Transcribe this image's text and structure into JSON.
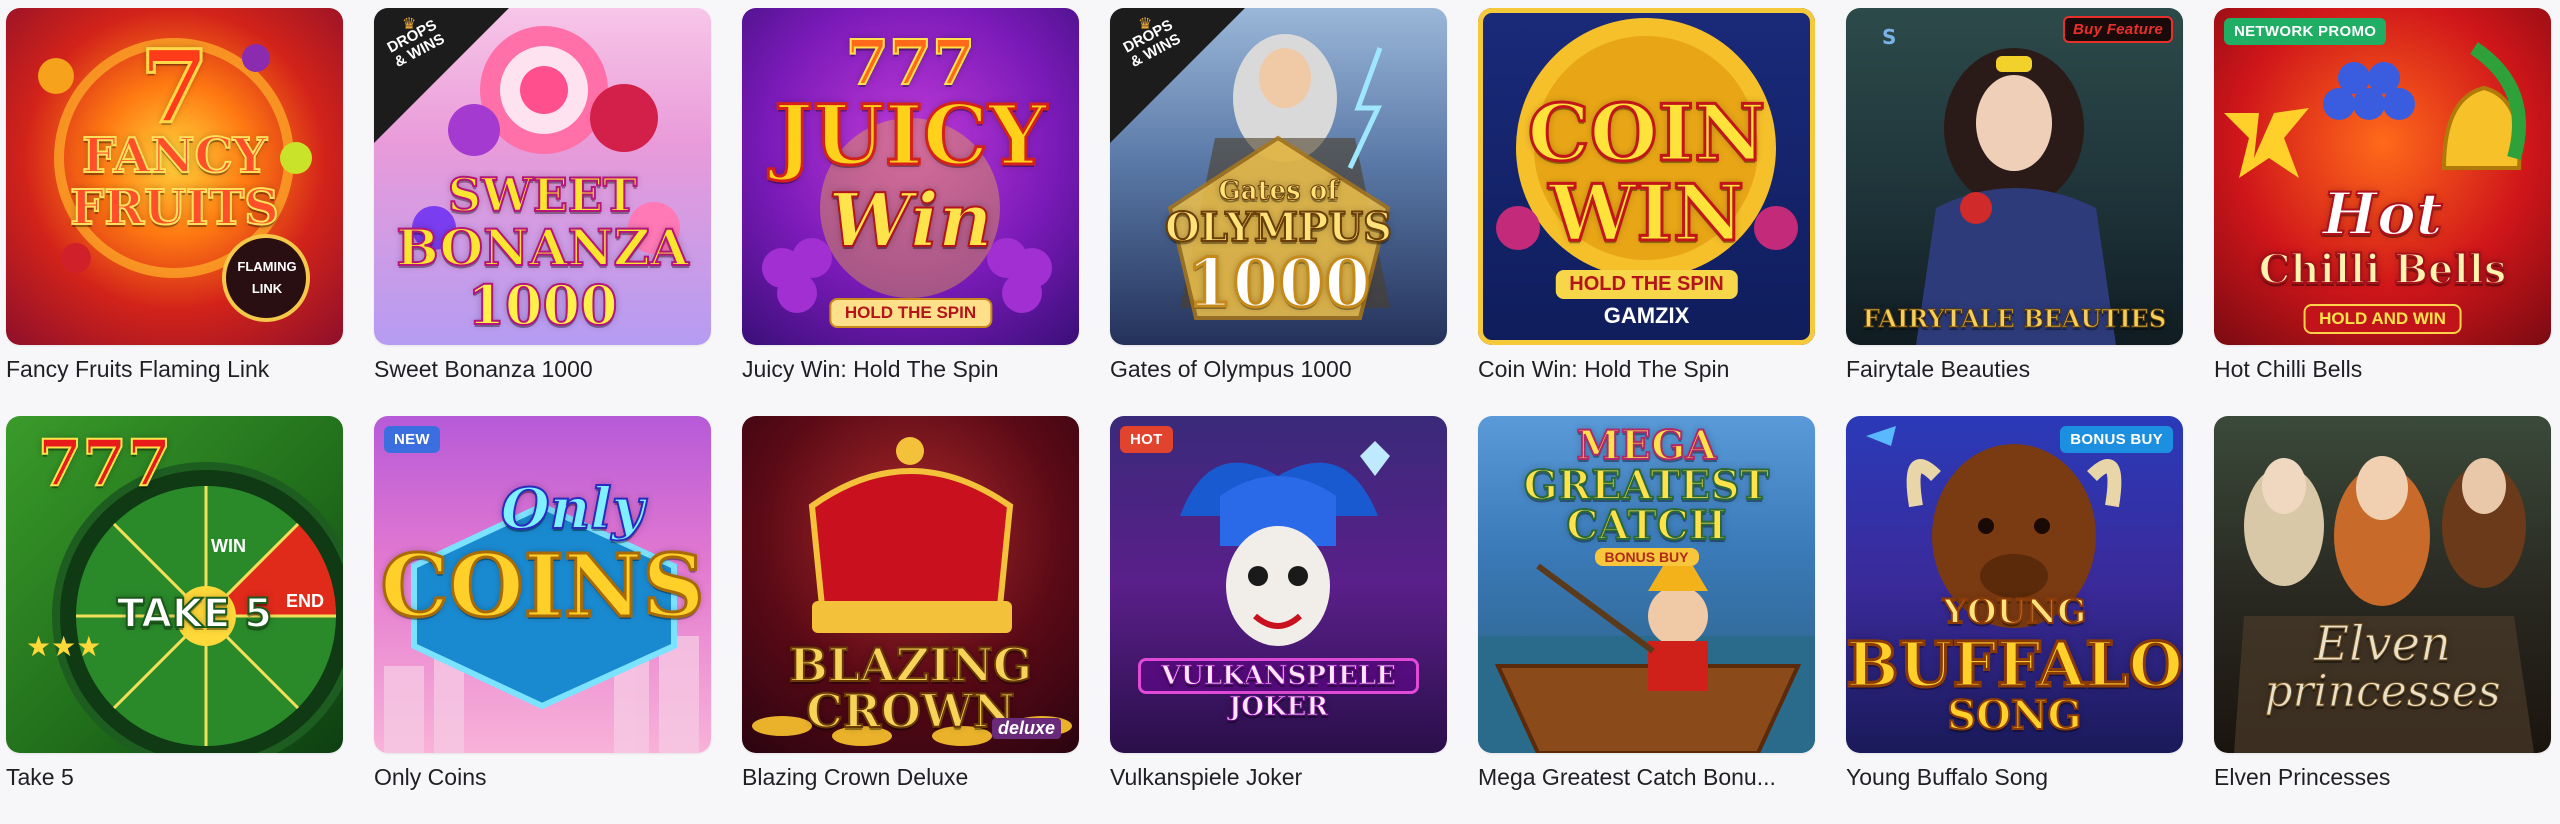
{
  "games": [
    {
      "title": "Fancy Fruits Flaming Link",
      "art": {
        "line1": "FANCY",
        "line2": "FRUITS",
        "extra": "FLAMING LINK",
        "big": "7"
      }
    },
    {
      "title": "Sweet Bonanza 1000",
      "badge_corner": "DROPS & WINS",
      "art": {
        "line1": "SWEET",
        "line2": "BONANZA",
        "extra": "1000"
      }
    },
    {
      "title": "Juicy Win: Hold The Spin",
      "art": {
        "big": "777",
        "line1": "JUICY",
        "line2": "Win",
        "extra": "HOLD THE SPIN"
      }
    },
    {
      "title": "Gates of Olympus 1000",
      "badge_corner": "DROPS & WINS",
      "art": {
        "line1": "Gates of",
        "line2": "OLYMPUS",
        "extra": "1000"
      }
    },
    {
      "title": "Coin Win: Hold The Spin",
      "art": {
        "line1": "COIN",
        "line2": "WIN",
        "extra": "HOLD THE SPIN",
        "provider": "GAMZIX"
      }
    },
    {
      "title": "Fairytale Beauties",
      "badge": "Buy Feature",
      "art": {
        "line1": "FAIRYTALE BEAUTIES"
      }
    },
    {
      "title": "Hot Chilli Bells",
      "badge": "NETWORK PROMO",
      "art": {
        "line1": "Hot",
        "line2": "Chilli Bells",
        "extra": "HOLD AND WIN"
      }
    },
    {
      "title": "Take 5",
      "art": {
        "big": "777",
        "line1": "TAKE 5",
        "win": "WIN",
        "end": "END"
      }
    },
    {
      "title": "Only Coins",
      "badge": "NEW",
      "art": {
        "line1": "Only",
        "line2": "COINS"
      }
    },
    {
      "title": "Blazing Crown Deluxe",
      "art": {
        "line1": "BLAZING",
        "line2": "CROWN",
        "extra": "deluxe"
      }
    },
    {
      "title": "Vulkanspiele Joker",
      "badge": "HOT",
      "art": {
        "line1": "VULKANSPIELE",
        "line2": "JOKER"
      }
    },
    {
      "title": "Mega Greatest Catch Bonu...",
      "art": {
        "line1": "MEGA",
        "line2": "GREATEST",
        "line3": "CATCH",
        "extra": "BONUS BUY"
      }
    },
    {
      "title": "Young Buffalo Song",
      "badge": "BONUS BUY",
      "art": {
        "line1": "YOUNG",
        "line2": "BUFFALO",
        "line3": "SONG"
      }
    },
    {
      "title": "Elven Princesses",
      "art": {
        "line1": "Elven",
        "line2": "princesses"
      }
    }
  ],
  "colors": {
    "badge_new": "#3b6fe0",
    "badge_hot": "#e2432d",
    "badge_network": "#1fae63",
    "badge_bonus": "#1d8fe0",
    "badge_buy": "#c8102e"
  },
  "icons": {
    "drops_wins": "crown-icon"
  }
}
